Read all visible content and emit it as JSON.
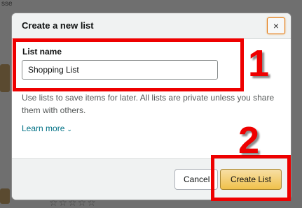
{
  "background": {
    "corner_text": "sse",
    "stars": "☆☆☆☆☆"
  },
  "dialog": {
    "title": "Create a new list",
    "close_label": "×",
    "field_label": "List name",
    "input_value": "Shopping List",
    "helper_text": "Use lists to save items for later. All lists are private unless you share them with others.",
    "learn_more": "Learn more",
    "learn_more_icon": "chevron-down-icon",
    "cancel_label": "Cancel",
    "create_label": "Create List"
  },
  "annotations": {
    "step_1": "1",
    "step_2": "2",
    "color": "#ee0000"
  }
}
